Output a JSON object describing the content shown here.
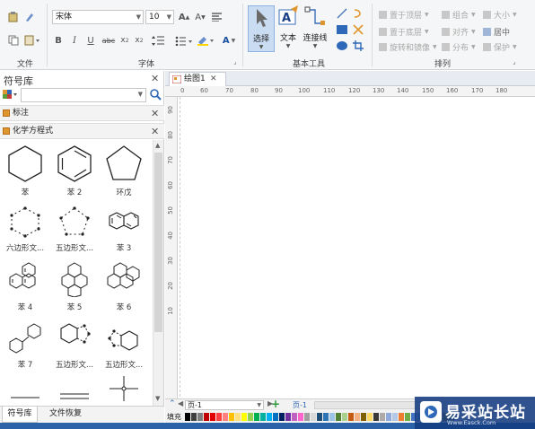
{
  "ribbon": {
    "groups": {
      "file": "文件",
      "font": "字体",
      "basic_tools": "基本工具",
      "arrange": "排列"
    },
    "font_name": "宋体",
    "font_size": "10",
    "select_label": "选择",
    "text_label": "文本",
    "connector_label": "连接线",
    "arrange_items": {
      "bring_front": "置于顶层",
      "send_back": "置于底层",
      "rotate_mirror": "旋转和镜像",
      "group": "组合",
      "align": "对齐",
      "distribute": "分布",
      "size": "大小",
      "center": "居中",
      "protect": "保护"
    }
  },
  "left_panel": {
    "title": "符号库",
    "search_placeholder": "",
    "section_annotation": "标注",
    "section_chem": "化学方程式",
    "shapes": [
      "苯",
      "苯 2",
      "环戊",
      "六边形文...",
      "五边形文...",
      "苯 3",
      "苯 4",
      "苯 5",
      "苯 6",
      "苯 7",
      "五边形文...",
      "五边形文..."
    ],
    "tab_library": "符号库",
    "tab_file_recovery": "文件恢复"
  },
  "document": {
    "tab_name": "绘图1",
    "ruler_top": [
      "0",
      "60",
      "70",
      "80",
      "90",
      "100",
      "110",
      "120",
      "130",
      "140",
      "150",
      "160",
      "170",
      "180"
    ],
    "ruler_left": [
      "90",
      "80",
      "70",
      "60",
      "50",
      "40",
      "30",
      "20",
      "10"
    ],
    "page_select": "页-1",
    "page_tab": "页-1",
    "fill_label": "填充"
  },
  "watermark": {
    "title": "易采站长站",
    "subtitle": "Www.Easck.Com"
  },
  "palette": [
    "#000000",
    "#404040",
    "#7f7f7f",
    "#c00000",
    "#e00000",
    "#ff4040",
    "#ff8080",
    "#ffc000",
    "#ffe080",
    "#ffff00",
    "#92d050",
    "#00b050",
    "#00b0a0",
    "#00b0f0",
    "#0070c0",
    "#002060",
    "#7030a0",
    "#c060c0",
    "#ff66cc",
    "#a0a0a0",
    "#d9d9d9",
    "#1f4e79",
    "#2e75b6",
    "#9dc3e6",
    "#548235",
    "#a9d18e",
    "#c55a11",
    "#f4b183",
    "#7f6000",
    "#ffd966",
    "#3a3838",
    "#aeaaaa",
    "#8faadc",
    "#b4c7e7",
    "#ed7d31",
    "#70ad47",
    "#4472c4",
    "#5b9bd5",
    "#264478",
    "#9e480e",
    "#636363",
    "#997300",
    "#43682b"
  ]
}
